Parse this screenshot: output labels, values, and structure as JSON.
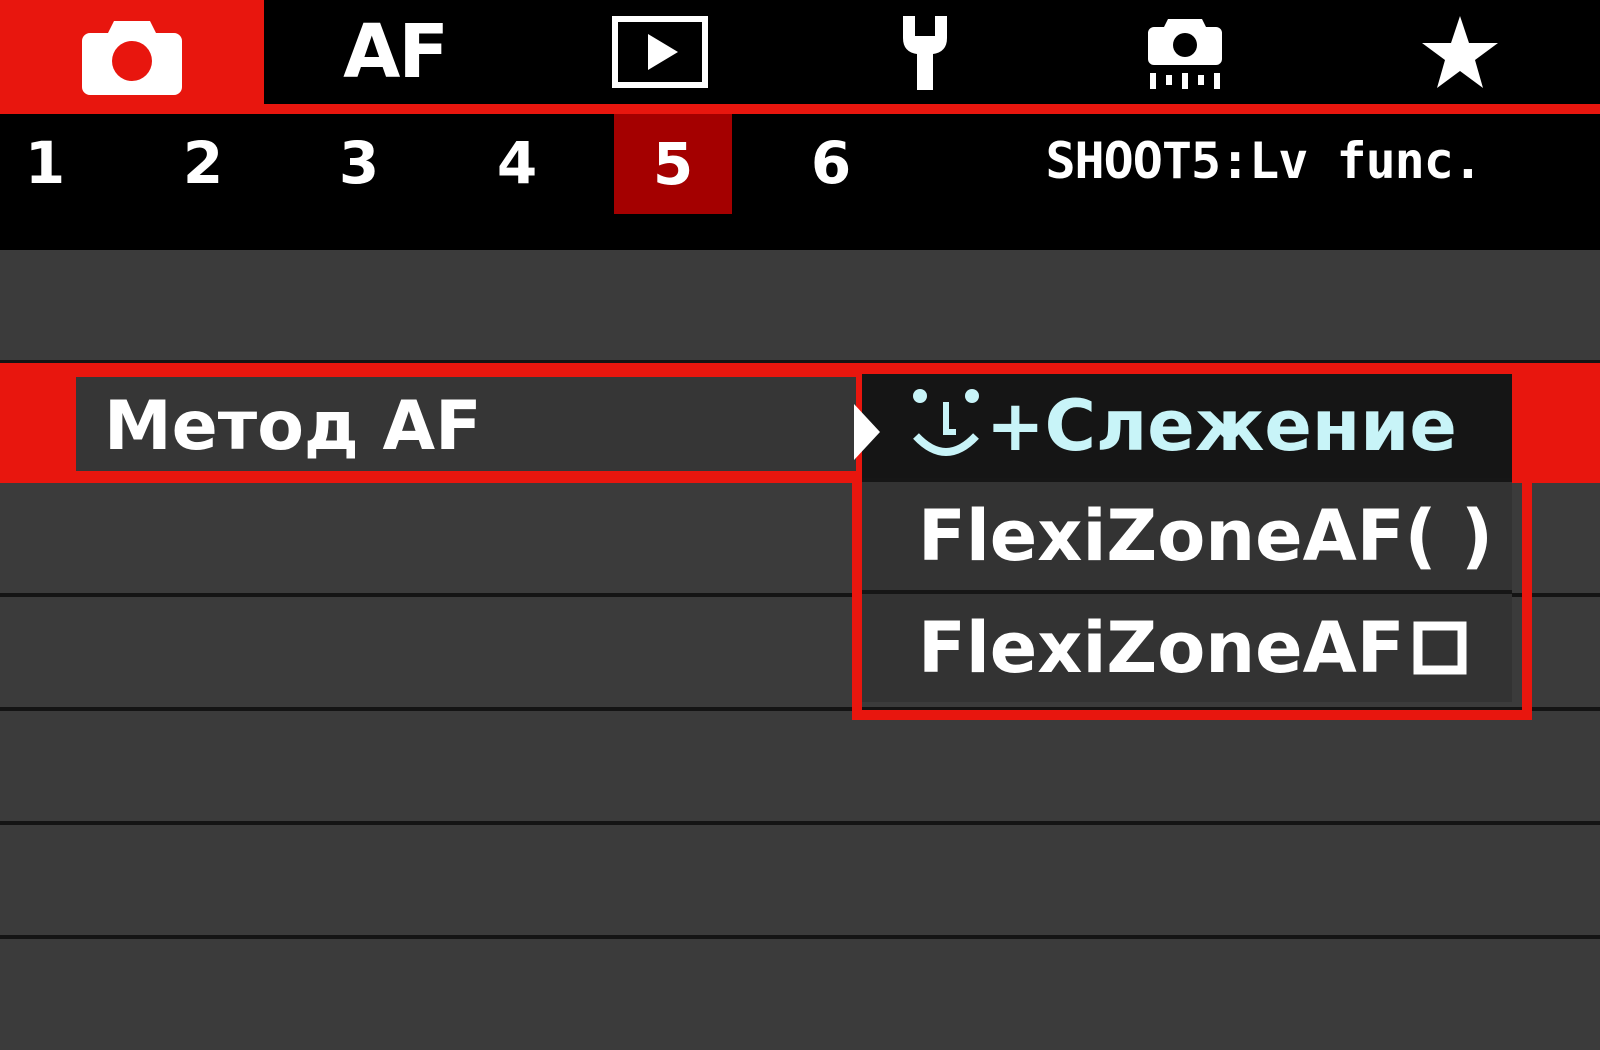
{
  "tabs": [
    {
      "icon": "camera-icon",
      "active": true
    },
    {
      "label": "AF",
      "active": false
    },
    {
      "icon": "play-icon",
      "active": false
    },
    {
      "icon": "wrench-icon",
      "active": false
    },
    {
      "icon": "custom-functions-icon",
      "active": false
    },
    {
      "icon": "star-icon",
      "active": false
    }
  ],
  "pages": [
    "1",
    "2",
    "3",
    "4",
    "5",
    "6"
  ],
  "active_page": "5",
  "page_title": "SHOOT5:Lv func.",
  "menu": {
    "label": "Метод AF"
  },
  "dropdown": {
    "options": [
      {
        "label": "+Слежение",
        "icon": "face-icon",
        "selected": true
      },
      {
        "label": "FlexiZoneAF( )",
        "selected": false
      },
      {
        "label": "FlexiZoneAF",
        "icon": "single-point-square-icon",
        "selected": false
      }
    ]
  },
  "colors": {
    "accent": "#e8160e",
    "active_page": "#a40000",
    "selected_text": "#c8f4f8"
  }
}
